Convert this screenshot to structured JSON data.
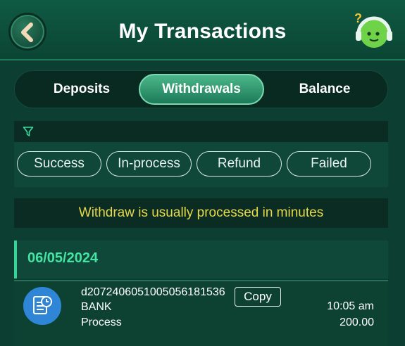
{
  "header": {
    "title": "My Transactions",
    "back_icon": "chevron-left-icon",
    "support_icon": "support-headset-icon"
  },
  "tabs": [
    {
      "label": "Deposits",
      "active": false
    },
    {
      "label": "Withdrawals",
      "active": true
    },
    {
      "label": "Balance",
      "active": false
    }
  ],
  "filter": {
    "icon": "filter-icon",
    "chips": [
      "Success",
      "In-process",
      "Refund",
      "Failed"
    ]
  },
  "notice": "Withdraw is usually processed in minutes",
  "transactions": {
    "date": "06/05/2024",
    "items": [
      {
        "id": "d2072406051005056181536",
        "copy_label": "Copy",
        "method": "BANK",
        "status": "Process",
        "time": "10:05 am",
        "amount": "200.00",
        "icon": "receipt-clock-icon"
      }
    ]
  },
  "colors": {
    "background": "#0c3f31",
    "accent": "#45e3a4",
    "notice_text": "#e6d84b",
    "active_tab": "#1c7a58",
    "tx_icon_bg": "#2f86d6"
  }
}
